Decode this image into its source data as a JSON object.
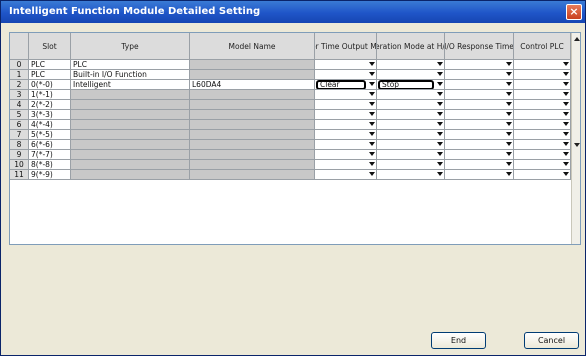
{
  "window": {
    "title": "Intelligent Function Module Detailed Setting",
    "close": "×"
  },
  "table": {
    "headers": [
      "",
      "Slot",
      "Type",
      "Model Name",
      "Error Time Output Mode",
      "PLC Operation Mode at H/W Error",
      "I/O Response Time",
      "Control PLC"
    ],
    "rows": [
      {
        "idx": "0",
        "slot": "PLC",
        "type": "PLC",
        "model": "",
        "err": "",
        "plc": ""
      },
      {
        "idx": "1",
        "slot": "PLC",
        "type": "Built-in I/O Function",
        "model": "",
        "err": "",
        "plc": ""
      },
      {
        "idx": "2",
        "slot": "0(*-0)",
        "type": "Intelligent",
        "model": "L60DA4",
        "err": "Clear",
        "plc": "Stop"
      },
      {
        "idx": "3",
        "slot": "1(*-1)",
        "type": "",
        "model": "",
        "err": "",
        "plc": ""
      },
      {
        "idx": "4",
        "slot": "2(*-2)",
        "type": "",
        "model": "",
        "err": "",
        "plc": ""
      },
      {
        "idx": "5",
        "slot": "3(*-3)",
        "type": "",
        "model": "",
        "err": "",
        "plc": ""
      },
      {
        "idx": "6",
        "slot": "4(*-4)",
        "type": "",
        "model": "",
        "err": "",
        "plc": ""
      },
      {
        "idx": "7",
        "slot": "5(*-5)",
        "type": "",
        "model": "",
        "err": "",
        "plc": ""
      },
      {
        "idx": "8",
        "slot": "6(*-6)",
        "type": "",
        "model": "",
        "err": "",
        "plc": ""
      },
      {
        "idx": "9",
        "slot": "7(*-7)",
        "type": "",
        "model": "",
        "err": "",
        "plc": ""
      },
      {
        "idx": "10",
        "slot": "8(*-8)",
        "type": "",
        "model": "",
        "err": "",
        "plc": ""
      },
      {
        "idx": "11",
        "slot": "9(*-9)",
        "type": "",
        "model": "",
        "err": "",
        "plc": ""
      }
    ]
  },
  "buttons": {
    "end": "End",
    "cancel": "Cancel"
  },
  "colors": {
    "titlebar": "#1f55c8",
    "gray_cell": "#c8c8c8"
  }
}
